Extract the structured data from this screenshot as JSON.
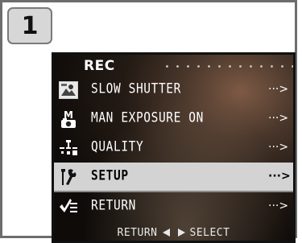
{
  "step": "1",
  "menu": {
    "title": "REC",
    "items": [
      {
        "label": "SLOW SHUTTER",
        "more": "···>",
        "icon": "slow-shutter-icon",
        "selected": false
      },
      {
        "label": "MAN EXPOSURE ON",
        "more": "···>",
        "icon": "manual-exposure-icon",
        "selected": false
      },
      {
        "label": "QUALITY",
        "more": "···>",
        "icon": "quality-icon",
        "selected": false
      },
      {
        "label": "SETUP",
        "more": "···>",
        "icon": "setup-icon",
        "selected": true
      },
      {
        "label": "RETURN",
        "more": "···>",
        "icon": "return-icon",
        "selected": false
      }
    ]
  },
  "footer": {
    "left": "RETURN",
    "right": "SELECT"
  },
  "colors": {
    "highlight": "#d3d3d3",
    "text": "#ffffff",
    "selected_text": "#000000"
  }
}
